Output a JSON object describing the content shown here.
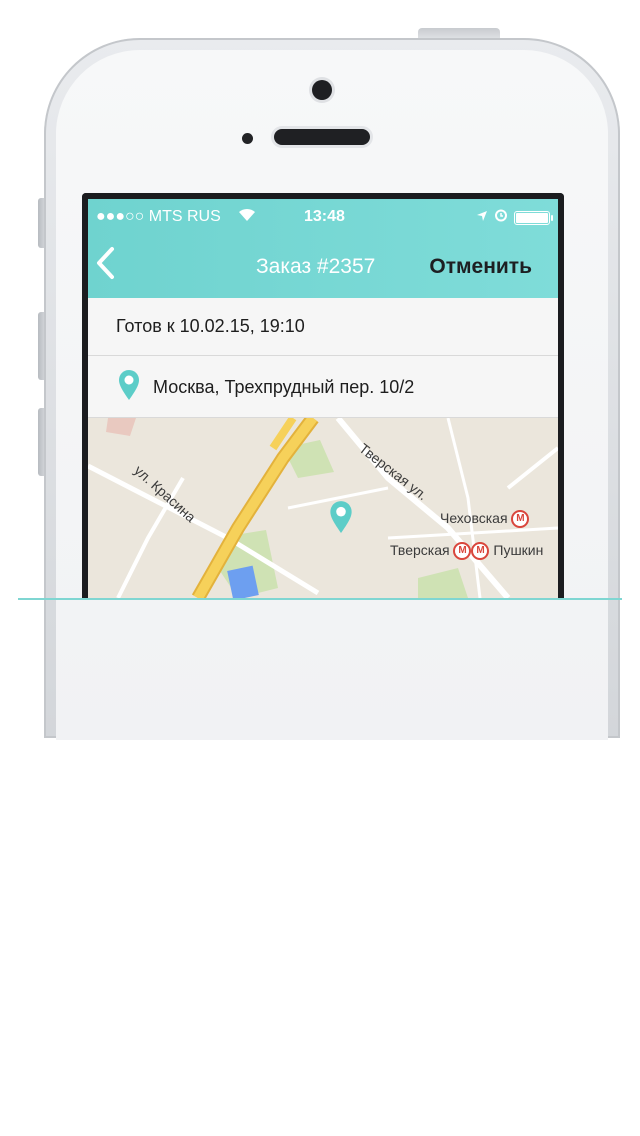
{
  "status_bar": {
    "carrier": "●●●○○ MTS RUS",
    "time": "13:48",
    "icons": [
      "wifi-icon",
      "location-arrow-icon",
      "alarm-icon",
      "battery-icon"
    ]
  },
  "navbar": {
    "title": "Заказ #2357",
    "action": "Отменить",
    "back_icon": "chevron-left-icon"
  },
  "order": {
    "ready": "Готов к 10.02.15, 19:10",
    "address": "Москва, Трехпрудный пер. 10/2"
  },
  "map": {
    "street_krasina": "ул. Красина",
    "street_tverskaya": "Тверская ул.",
    "metro_chekhovskaya": "Чеховская",
    "metro_tverskaya": "Тверская",
    "metro_pushkinskaya": "Пушкин",
    "metro_symbol": "М",
    "pin_icon": "map-pin-icon"
  },
  "footer": {
    "line1": "",
    "lines": [
      "",
      "",
      ""
    ]
  },
  "colors": {
    "accent": "#6fd3cf",
    "row_bg": "#f6f6f6",
    "map_bg": "#ebe6dc",
    "road_major": "#f3c842",
    "metro": "#d9463c"
  }
}
